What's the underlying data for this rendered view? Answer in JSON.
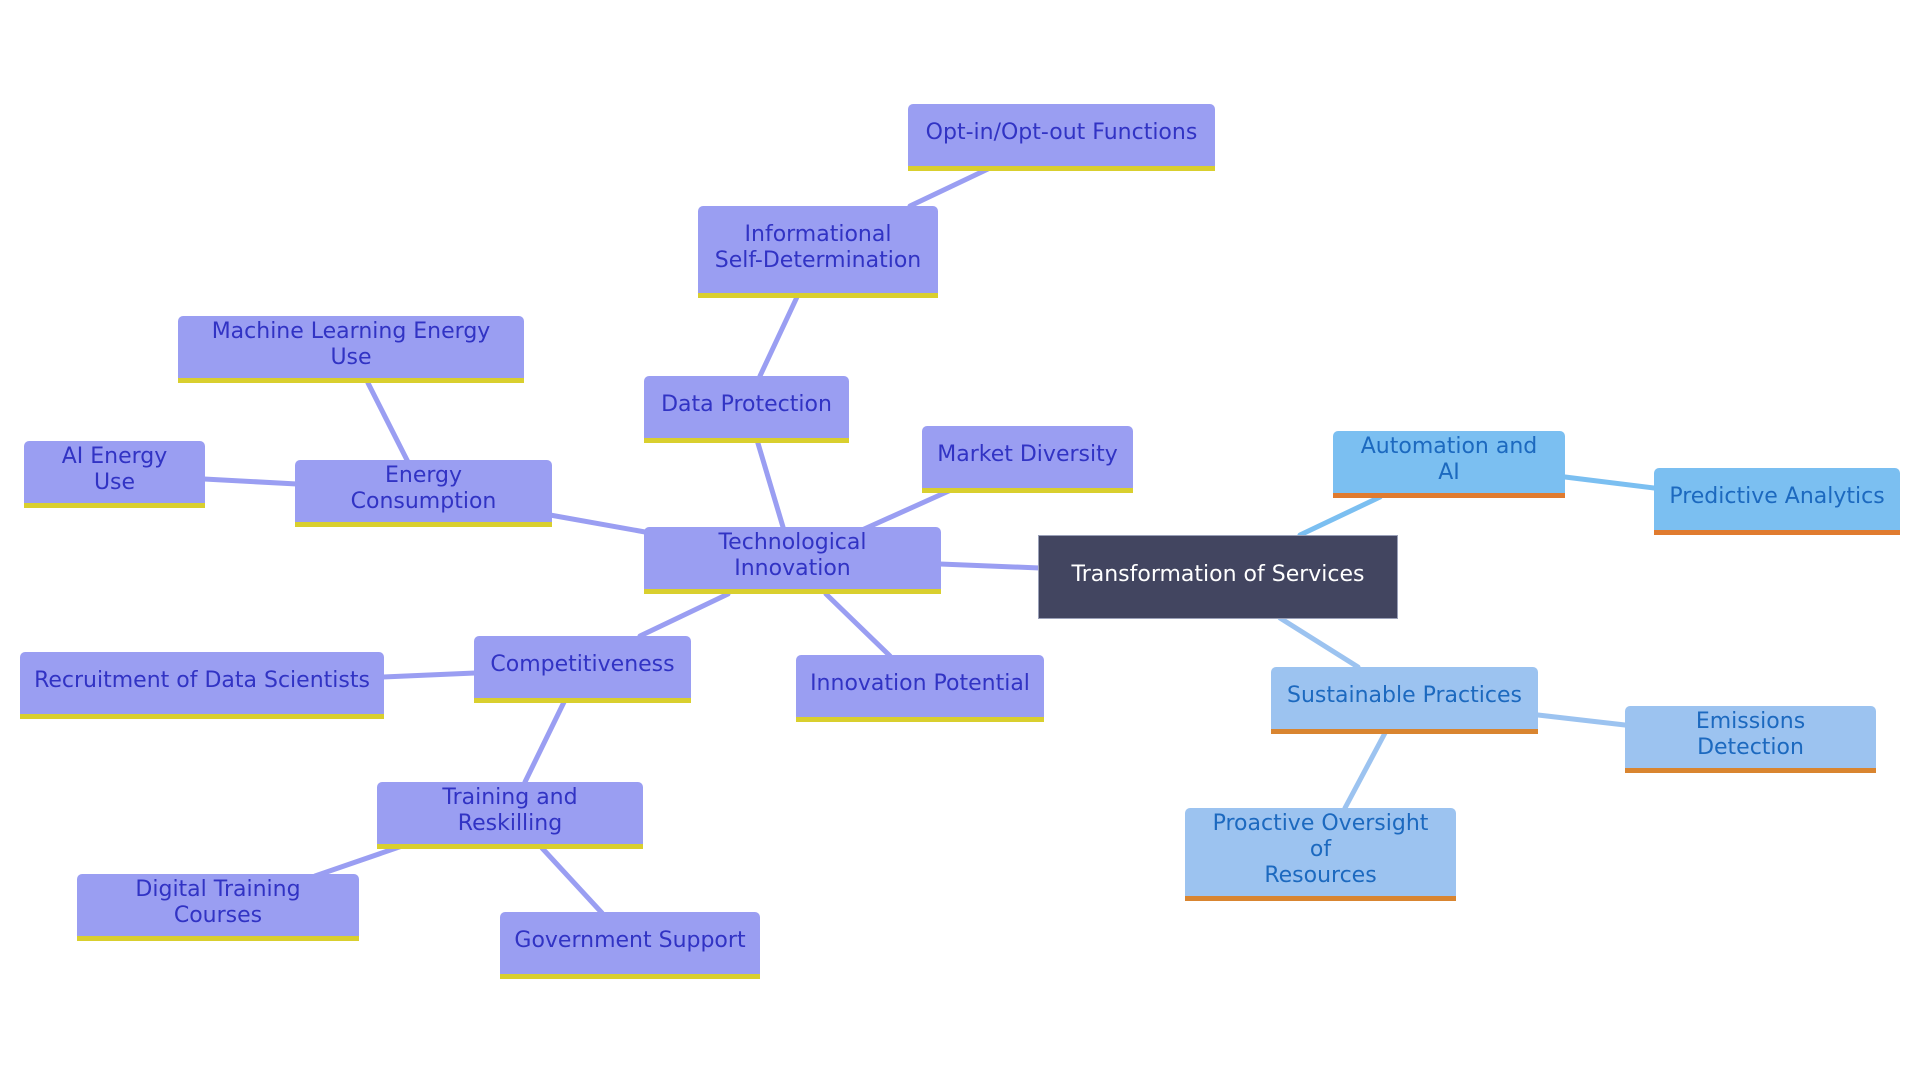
{
  "diagram": {
    "type": "mindmap",
    "root": {
      "id": "root",
      "label": "Transformation of Services"
    },
    "nodes": [
      {
        "id": "tech",
        "label": "Technological Innovation",
        "parent": "root",
        "style": "purple"
      },
      {
        "id": "energy",
        "label": "Energy Consumption",
        "parent": "tech",
        "style": "purple"
      },
      {
        "id": "ml",
        "label": "Machine Learning Energy Use",
        "parent": "energy",
        "style": "purple"
      },
      {
        "id": "ai_energy",
        "label": "AI Energy Use",
        "parent": "energy",
        "style": "purple"
      },
      {
        "id": "dataprot",
        "label": "Data Protection",
        "parent": "tech",
        "style": "purple"
      },
      {
        "id": "infoself",
        "label": "Informational Self-Determination",
        "lines": [
          "Informational",
          "Self-Determination"
        ],
        "parent": "dataprot",
        "style": "purple"
      },
      {
        "id": "optin",
        "label": "Opt-in/Opt-out Functions",
        "parent": "infoself",
        "style": "purple"
      },
      {
        "id": "market",
        "label": "Market Diversity",
        "parent": "tech",
        "style": "purple"
      },
      {
        "id": "innov",
        "label": "Innovation Potential",
        "parent": "tech",
        "style": "purple"
      },
      {
        "id": "compet",
        "label": "Competitiveness",
        "parent": "tech",
        "style": "purple"
      },
      {
        "id": "recruit",
        "label": "Recruitment of Data Scientists",
        "parent": "compet",
        "style": "purple"
      },
      {
        "id": "training",
        "label": "Training and Reskilling",
        "parent": "compet",
        "style": "purple"
      },
      {
        "id": "digital",
        "label": "Digital Training Courses",
        "parent": "training",
        "style": "purple"
      },
      {
        "id": "gov",
        "label": "Government Support",
        "parent": "training",
        "style": "purple"
      },
      {
        "id": "auto",
        "label": "Automation and AI",
        "parent": "root",
        "style": "blue"
      },
      {
        "id": "predict",
        "label": "Predictive Analytics",
        "parent": "auto",
        "style": "blue"
      },
      {
        "id": "sustain",
        "label": "Sustainable Practices",
        "parent": "root",
        "style": "lightblue"
      },
      {
        "id": "emis",
        "label": "Emissions Detection",
        "parent": "sustain",
        "style": "lightblue"
      },
      {
        "id": "proactive",
        "label": "Proactive Oversight of Resources",
        "lines": [
          "Proactive Oversight of",
          "Resources"
        ],
        "parent": "sustain",
        "style": "lightblue"
      }
    ],
    "colors": {
      "purple_fill": "#9a9ef2",
      "purple_text": "#3133c4",
      "purple_accent": "#d9cf2e",
      "blue_fill": "#7bbff1",
      "lightblue_fill": "#9cc3f0",
      "blue_text": "#1c69bf",
      "orange_accent": "#e07b2f",
      "root_fill": "#424560",
      "root_text": "#ffffff"
    }
  }
}
